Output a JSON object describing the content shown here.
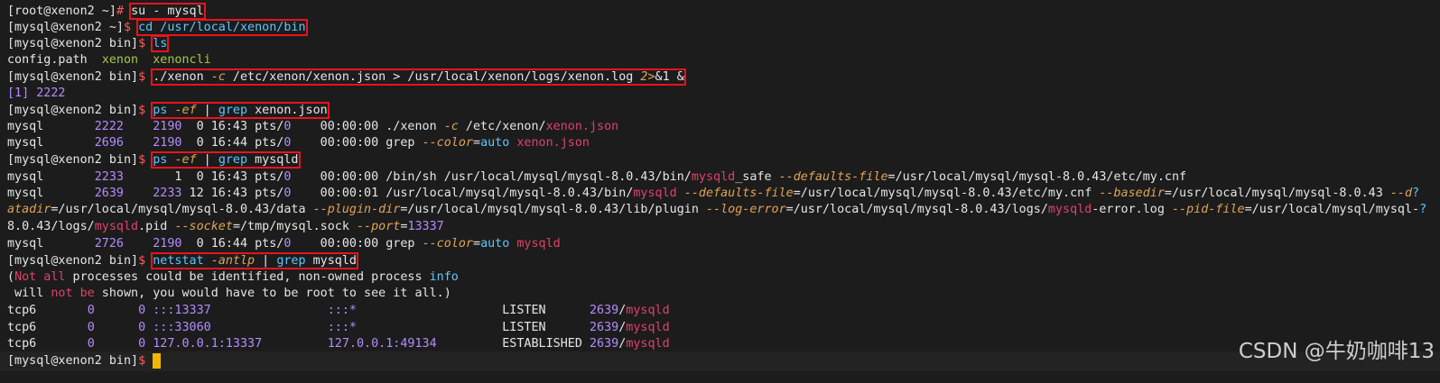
{
  "colors": {
    "background": "#1c1c1c",
    "text": "#e6e6e6",
    "prompt_dollar": "#ff5a5a",
    "cmd_blue": "#5cc8ff",
    "flag_orange": "#e0a458",
    "number_purple": "#b48cff",
    "match_red": "#e0426a",
    "exe_green": "#a6c846",
    "highlight_box": "#e8141c",
    "cursor": "#f2b800"
  },
  "terminal": {
    "lines": [
      {
        "box": 1,
        "segs": [
          [
            "[root@xenon2 ~]",
            "t"
          ],
          [
            "#",
            "d"
          ],
          [
            " ",
            "t"
          ],
          [
            "su - mysql",
            "t",
            "box"
          ]
        ]
      },
      {
        "segs": [
          [
            "[mysql@xenon2 ~]",
            "t"
          ],
          [
            "$",
            "d"
          ],
          [
            " ",
            "t"
          ],
          [
            "cd /usr/local/xenon/bin",
            "b",
            "box"
          ]
        ]
      },
      {
        "segs": [
          [
            "[mysql@xenon2 bin]",
            "t"
          ],
          [
            "$",
            "d"
          ],
          [
            " ",
            "t"
          ],
          [
            "ls",
            "b",
            "box"
          ]
        ]
      },
      {
        "segs": [
          [
            "config.path  ",
            "t"
          ],
          [
            "xenon",
            "g"
          ],
          [
            "  ",
            "t"
          ],
          [
            "xenoncli",
            "g"
          ]
        ]
      },
      {
        "segs": [
          [
            "[mysql@xenon2 bin]",
            "t"
          ],
          [
            "$",
            "d"
          ],
          [
            " ",
            "t"
          ],
          [
            "./xenon ",
            "box-t"
          ],
          [
            "-c",
            "o",
            "box"
          ],
          [
            " /etc/xenon/xenon.json > /usr/local/xenon/logs/xenon.log ",
            "box-t"
          ],
          [
            "2>",
            "o",
            "box"
          ],
          [
            "&1 &",
            "box-t"
          ]
        ]
      },
      {
        "segs": [
          [
            "[1] 2222",
            "p"
          ]
        ]
      },
      {
        "segs": [
          [
            "[mysql@xenon2 bin]",
            "t"
          ],
          [
            "$",
            "d"
          ],
          [
            " ",
            "t"
          ],
          [
            "ps ",
            "b",
            "box"
          ],
          [
            "-ef",
            "o",
            "box"
          ],
          [
            " | ",
            "box-t"
          ],
          [
            "grep",
            "b",
            "box"
          ],
          [
            " xenon.json",
            "box-t"
          ]
        ]
      },
      {
        "segs": [
          [
            "mysql       ",
            "t"
          ],
          [
            "2222",
            "p"
          ],
          [
            "    ",
            "t"
          ],
          [
            "2190",
            "p"
          ],
          [
            "  0 16:43 pts/",
            "t"
          ],
          [
            "0",
            "p"
          ],
          [
            "    00:00:00 ./xenon ",
            "t"
          ],
          [
            "-c",
            "o"
          ],
          [
            " /etc/xenon/",
            "t"
          ],
          [
            "xenon.json",
            "r"
          ]
        ]
      },
      {
        "segs": [
          [
            "mysql       ",
            "t"
          ],
          [
            "2696",
            "p"
          ],
          [
            "    ",
            "t"
          ],
          [
            "2190",
            "p"
          ],
          [
            "  0 16:44 pts/",
            "t"
          ],
          [
            "0",
            "p"
          ],
          [
            "    00:00:00 grep ",
            "t"
          ],
          [
            "--color",
            "o"
          ],
          [
            "=",
            "t"
          ],
          [
            "auto",
            "b"
          ],
          [
            " ",
            "t"
          ],
          [
            "xenon.json",
            "r"
          ]
        ]
      },
      {
        "segs": [
          [
            "[mysql@xenon2 bin]",
            "t"
          ],
          [
            "$",
            "d"
          ],
          [
            " ",
            "t"
          ],
          [
            "ps ",
            "b",
            "box"
          ],
          [
            "-ef",
            "o",
            "box"
          ],
          [
            " | ",
            "box-t"
          ],
          [
            "grep",
            "b",
            "box"
          ],
          [
            " mysqld",
            "box-t"
          ]
        ]
      },
      {
        "segs": [
          [
            "mysql       ",
            "t"
          ],
          [
            "2233",
            "p"
          ],
          [
            "       1  0 16:43 pts/",
            "t"
          ],
          [
            "0",
            "p"
          ],
          [
            "    00:00:00 /bin/sh /usr/local/mysql/mysql-8.0.43/bin/",
            "t"
          ],
          [
            "mysqld",
            "r"
          ],
          [
            "_safe ",
            "t"
          ],
          [
            "--defaults-file",
            "o"
          ],
          [
            "=/usr/local/mysql/mysql-8.0.43/etc/my.cnf",
            "t"
          ]
        ]
      },
      {
        "segs": [
          [
            "mysql       ",
            "t"
          ],
          [
            "2639",
            "p"
          ],
          [
            "    ",
            "t"
          ],
          [
            "2233",
            "p"
          ],
          [
            " 12 16:43 pts/",
            "t"
          ],
          [
            "0",
            "p"
          ],
          [
            "    00:00:01 /usr/local/mysql/mysql-8.0.43/bin/",
            "t"
          ],
          [
            "mysqld",
            "r"
          ],
          [
            " ",
            "t"
          ],
          [
            "--defaults-file",
            "o"
          ],
          [
            "=/usr/local/mysql/mysql-8.0.43/etc/my.cnf ",
            "t"
          ],
          [
            "--basedir",
            "o"
          ],
          [
            "=/usr/local/mysql/mysql-8.0.43 ",
            "t"
          ],
          [
            "--d",
            "o"
          ],
          [
            "?",
            "b"
          ]
        ]
      },
      {
        "segs": [
          [
            "atadir",
            "o"
          ],
          [
            "=/usr/local/mysql/mysql-8.0.43/data ",
            "t"
          ],
          [
            "--plugin-dir",
            "o"
          ],
          [
            "=/usr/local/mysql/mysql-8.0.43/lib/plugin ",
            "t"
          ],
          [
            "--log-error",
            "o"
          ],
          [
            "=/usr/local/mysql/mysql-8.0.43/logs/",
            "t"
          ],
          [
            "mysqld",
            "r"
          ],
          [
            "-error.log ",
            "t"
          ],
          [
            "--pid-file",
            "o"
          ],
          [
            "=/usr/local/mysql/mysql-",
            "t"
          ],
          [
            "?",
            "b"
          ]
        ]
      },
      {
        "segs": [
          [
            "8.0.43/logs/",
            "t"
          ],
          [
            "mysqld",
            "r"
          ],
          [
            ".pid ",
            "t"
          ],
          [
            "--socket",
            "o"
          ],
          [
            "=/tmp/mysql.sock ",
            "t"
          ],
          [
            "--port",
            "o"
          ],
          [
            "=",
            "t"
          ],
          [
            "13337",
            "p"
          ]
        ]
      },
      {
        "segs": [
          [
            "mysql       ",
            "t"
          ],
          [
            "2726",
            "p"
          ],
          [
            "    ",
            "t"
          ],
          [
            "2190",
            "p"
          ],
          [
            "  0 16:44 pts/",
            "t"
          ],
          [
            "0",
            "p"
          ],
          [
            "    00:00:00 grep ",
            "t"
          ],
          [
            "--color",
            "o"
          ],
          [
            "=",
            "t"
          ],
          [
            "auto",
            "b"
          ],
          [
            " ",
            "t"
          ],
          [
            "mysqld",
            "r"
          ]
        ]
      },
      {
        "segs": [
          [
            "[mysql@xenon2 bin]",
            "t"
          ],
          [
            "$",
            "d"
          ],
          [
            " ",
            "t"
          ],
          [
            "netstat ",
            "b",
            "box"
          ],
          [
            "-antlp",
            "o",
            "box"
          ],
          [
            " | ",
            "box-t"
          ],
          [
            "grep",
            "b",
            "box"
          ],
          [
            " mysqld",
            "box-t"
          ]
        ]
      },
      {
        "segs": [
          [
            "(",
            "t"
          ],
          [
            "Not all",
            "r"
          ],
          [
            " processes could be identified, non-owned process ",
            "t"
          ],
          [
            "info",
            "b"
          ]
        ]
      },
      {
        "segs": [
          [
            " will ",
            "t"
          ],
          [
            "not be",
            "r"
          ],
          [
            " shown, you would have to be root to see it all.)",
            "t"
          ]
        ]
      },
      {
        "segs": [
          [
            "tcp6       ",
            "t"
          ],
          [
            "0",
            "p"
          ],
          [
            "      ",
            "t"
          ],
          [
            "0",
            "p"
          ],
          [
            " ",
            "t"
          ],
          [
            ":::13337",
            "p"
          ],
          [
            "                ",
            "t"
          ],
          [
            ":::*",
            "p"
          ],
          [
            "                    LISTEN      ",
            "t"
          ],
          [
            "2639",
            "p"
          ],
          [
            "/",
            "t"
          ],
          [
            "mysqld",
            "r"
          ]
        ]
      },
      {
        "segs": [
          [
            "tcp6       ",
            "t"
          ],
          [
            "0",
            "p"
          ],
          [
            "      ",
            "t"
          ],
          [
            "0",
            "p"
          ],
          [
            " ",
            "t"
          ],
          [
            ":::33060",
            "p"
          ],
          [
            "                ",
            "t"
          ],
          [
            ":::*",
            "p"
          ],
          [
            "                    LISTEN      ",
            "t"
          ],
          [
            "2639",
            "p"
          ],
          [
            "/",
            "t"
          ],
          [
            "mysqld",
            "r"
          ]
        ]
      },
      {
        "segs": [
          [
            "tcp6       ",
            "t"
          ],
          [
            "0",
            "p"
          ],
          [
            "      ",
            "t"
          ],
          [
            "0",
            "p"
          ],
          [
            " ",
            "t"
          ],
          [
            "127.0.0.1:13337",
            "p"
          ],
          [
            "         ",
            "t"
          ],
          [
            "127.0.0.1:49134",
            "p"
          ],
          [
            "         ESTABLISHED ",
            "t"
          ],
          [
            "2639",
            "p"
          ],
          [
            "/",
            "t"
          ],
          [
            "mysqld",
            "r"
          ]
        ]
      },
      {
        "segs": [
          [
            "[mysql@xenon2 bin]",
            "t"
          ],
          [
            "$",
            "d"
          ],
          [
            " ",
            "t"
          ]
        ],
        "cursor": true
      }
    ]
  },
  "watermark": "CSDN @牛奶咖啡13"
}
